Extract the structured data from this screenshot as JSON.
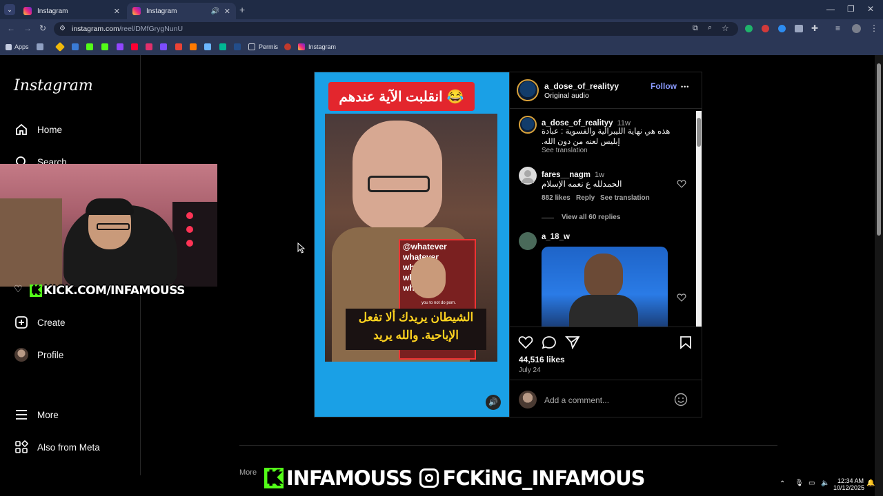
{
  "browser": {
    "tabs": [
      {
        "label": "Instagram",
        "active": false
      },
      {
        "label": "Instagram",
        "active": true
      }
    ],
    "url_host": "instagram.com",
    "url_path": "/reel/DMfGrygNunU",
    "bookmarks": [
      "Apps",
      "Permis",
      "Instagram"
    ]
  },
  "sidebar": {
    "logo": "Instagram",
    "items": [
      {
        "label": "Home",
        "icon": "home-icon"
      },
      {
        "label": "Search",
        "icon": "search-icon"
      },
      {
        "label": "Create",
        "icon": "create-icon"
      },
      {
        "label": "Profile",
        "icon": "profile-icon"
      },
      {
        "label": "More",
        "icon": "menu-icon"
      },
      {
        "label": "Also from Meta",
        "icon": "meta-apps-icon"
      }
    ]
  },
  "stream_overlay": {
    "kick_label": "KICK.COM/INFAMOUSS",
    "bottom_kick": "INFAMOUSS",
    "bottom_instagram": "FCKiNG_INFAMOUS"
  },
  "reel": {
    "top_caption": "انقلبت الآية عندهم",
    "emoji": "😂",
    "bottom_caption_line1": "الشيطان يريدك ألا تفعل",
    "bottom_caption_line2": "الإباحية. والله يريد",
    "inset_words": [
      "@whatever",
      "whatever",
      "whatever",
      "whatever",
      "whatever"
    ],
    "inset_subtitle": "you to not do porn."
  },
  "post": {
    "author": "a_dose_of_realityy",
    "audio": "Original audio",
    "follow_label": "Follow",
    "more_label": "•••",
    "caption_time": "11w",
    "caption_line1": "هذه هي نهاية الليبرالية والفسوية : عبادة",
    "caption_line2": ".إبليس لعنه من دون الله",
    "see_translation": "See translation",
    "comments": [
      {
        "user": "fares__nagm",
        "time": "1w",
        "text": "الحمدلله ع نعمه الإسلام",
        "likes": "882 likes",
        "reply": "Reply",
        "translate": "See translation",
        "replies": "View all 60 replies"
      },
      {
        "user": "a_18_w",
        "time": "",
        "text": ""
      }
    ],
    "likes": "44,516 likes",
    "date": "July 24",
    "add_comment_placeholder": "Add a comment..."
  },
  "more_posts_label": "More",
  "taskbar": {
    "time": "12:34 AM",
    "date": "10/12/2025"
  }
}
